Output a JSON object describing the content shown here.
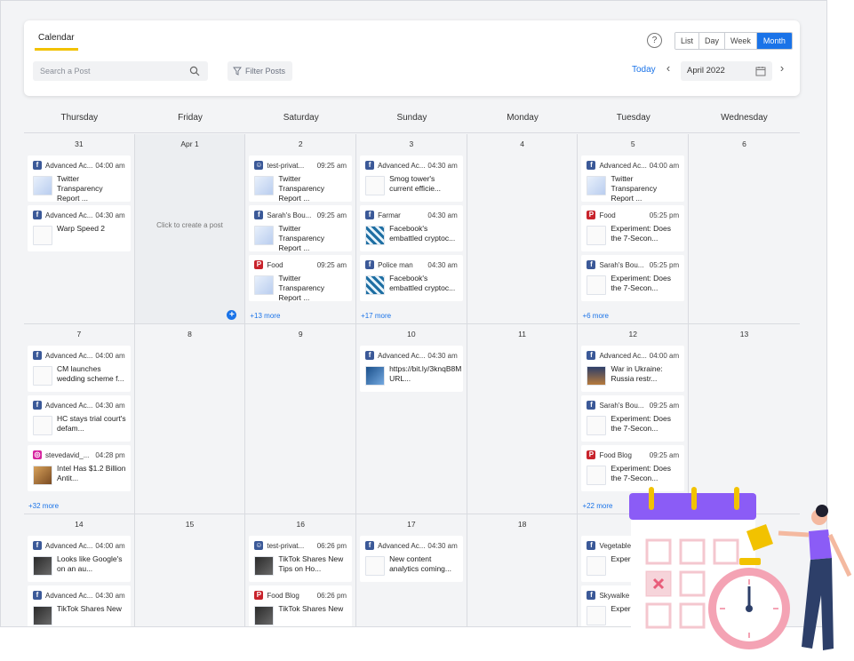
{
  "header": {
    "tab_label": "Calendar",
    "search_placeholder": "Search a Post",
    "filter_label": "Filter Posts",
    "help": "?",
    "views": [
      "List",
      "Day",
      "Week",
      "Month"
    ],
    "active_view": "Month",
    "today_label": "Today",
    "month_value": "April 2022"
  },
  "day_names": [
    "Thursday",
    "Friday",
    "Saturday",
    "Sunday",
    "Monday",
    "Tuesday",
    "Wednesday"
  ],
  "weeks": [
    {
      "days": [
        {
          "num": "31",
          "more": "",
          "posts": [
            {
              "icon": "fb",
              "account": "Advanced Ac...",
              "time": "04:00 am",
              "thumb": "",
              "text": "Twitter Transparency Report ..."
            },
            {
              "icon": "fb",
              "account": "Advanced Ac...",
              "time": "04:30 am",
              "thumb": "plain",
              "text": "Warp Speed 2"
            }
          ]
        },
        {
          "num": "Apr 1",
          "gray": true,
          "hint": "Click to create a post",
          "more": "",
          "posts": []
        },
        {
          "num": "2",
          "more": "+13 more",
          "posts": [
            {
              "icon": "grp",
              "account": "test-privat...",
              "time": "09:25 am",
              "thumb": "",
              "text": "Twitter Transparency Report ..."
            },
            {
              "icon": "fb",
              "account": "Sarah's Bou...",
              "time": "09:25 am",
              "thumb": "",
              "text": "Twitter Transparency Report ..."
            },
            {
              "icon": "pin",
              "account": "Food",
              "time": "09:25 am",
              "thumb": "",
              "text": "Twitter Transparency Report ..."
            }
          ]
        },
        {
          "num": "3",
          "more": "+17 more",
          "posts": [
            {
              "icon": "fb",
              "account": "Advanced Ac...",
              "time": "04:30 am",
              "thumb": "plain",
              "text": "Smog tower's current efficie..."
            },
            {
              "icon": "fb",
              "account": "Farmar",
              "time": "04:30 am",
              "thumb": "wave",
              "text": "Facebook's embattled cryptoc..."
            },
            {
              "icon": "fb",
              "account": "Police man",
              "time": "04:30 am",
              "thumb": "wave",
              "text": "Facebook's embattled cryptoc..."
            }
          ]
        },
        {
          "num": "4",
          "more": "",
          "posts": []
        },
        {
          "num": "5",
          "more": "+6 more",
          "posts": [
            {
              "icon": "fb",
              "account": "Advanced Ac...",
              "time": "04:00 am",
              "thumb": "",
              "text": "Twitter Transparency Report ..."
            },
            {
              "icon": "pin",
              "account": "Food",
              "time": "05:25 pm",
              "thumb": "plain",
              "text": "Experiment: Does the 7-Secon..."
            },
            {
              "icon": "fb",
              "account": "Sarah's Bou...",
              "time": "05:25 pm",
              "thumb": "plain",
              "text": "Experiment: Does the 7-Secon..."
            }
          ]
        },
        {
          "num": "6",
          "more": "",
          "posts": []
        }
      ]
    },
    {
      "days": [
        {
          "num": "7",
          "more": "+32 more",
          "posts": [
            {
              "icon": "fb",
              "account": "Advanced Ac...",
              "time": "04:00 am",
              "thumb": "plain",
              "text": "CM launches wedding scheme f..."
            },
            {
              "icon": "fb",
              "account": "Advanced Ac...",
              "time": "04:30 am",
              "thumb": "plain",
              "text": "HC stays trial court's defam..."
            },
            {
              "icon": "ig",
              "account": "stevedavid_...",
              "time": "04:28 pm",
              "thumb": "food",
              "text": "Intel Has $1.2 Billion Antit..."
            }
          ]
        },
        {
          "num": "8",
          "more": "",
          "posts": []
        },
        {
          "num": "9",
          "more": "",
          "posts": []
        },
        {
          "num": "10",
          "more": "",
          "posts": [
            {
              "icon": "fb",
              "account": "Advanced Ac...",
              "time": "04:30 am",
              "thumb": "blue",
              "text": "https://bit.ly/3knqB8M URL..."
            }
          ]
        },
        {
          "num": "11",
          "more": "",
          "posts": []
        },
        {
          "num": "12",
          "more": "+22 more",
          "posts": [
            {
              "icon": "fb",
              "account": "Advanced Ac...",
              "time": "04:00 am",
              "thumb": "war",
              "text": "War in Ukraine: Russia restr..."
            },
            {
              "icon": "fb",
              "account": "Sarah's Bou...",
              "time": "09:25 am",
              "thumb": "plain",
              "text": "Experiment: Does the 7-Secon..."
            },
            {
              "icon": "pin",
              "account": "Food Blog",
              "time": "09:25 am",
              "thumb": "plain",
              "text": "Experiment: Does the 7-Secon..."
            }
          ]
        },
        {
          "num": "13",
          "more": "",
          "posts": []
        }
      ]
    },
    {
      "days": [
        {
          "num": "14",
          "more": "",
          "posts": [
            {
              "icon": "fb",
              "account": "Advanced Ac...",
              "time": "04:00 am",
              "thumb": "dark",
              "text": "Looks like Google's on an au..."
            },
            {
              "icon": "fb",
              "account": "Advanced Ac...",
              "time": "04:30 am",
              "thumb": "dark",
              "text": "TikTok Shares New"
            }
          ]
        },
        {
          "num": "15",
          "more": "",
          "posts": []
        },
        {
          "num": "16",
          "more": "",
          "posts": [
            {
              "icon": "grp",
              "account": "test-privat...",
              "time": "06:26 pm",
              "thumb": "dark",
              "text": "TikTok Shares New Tips on Ho..."
            },
            {
              "icon": "pin",
              "account": "Food Blog",
              "time": "06:26 pm",
              "thumb": "dark",
              "text": "TikTok Shares New"
            }
          ]
        },
        {
          "num": "17",
          "more": "",
          "posts": [
            {
              "icon": "fb",
              "account": "Advanced Ac...",
              "time": "04:30 am",
              "thumb": "plain",
              "text": "New content analytics coming..."
            }
          ]
        },
        {
          "num": "18",
          "more": "",
          "posts": []
        },
        {
          "num": "",
          "more": "",
          "posts": [
            {
              "icon": "fb",
              "account": "Vegetable",
              "time": "",
              "thumb": "plain",
              "text": "Experim 7-Secon"
            },
            {
              "icon": "fb",
              "account": "Skywalke",
              "time": "",
              "thumb": "plain",
              "text": "Experim"
            }
          ]
        },
        {
          "num": "",
          "more": "",
          "posts": []
        }
      ]
    }
  ],
  "colors": {
    "accent": "#1a73e8",
    "tab_underline": "#f2c200",
    "illustration_purple": "#8b5cf6",
    "illustration_pink": "#f4a3b4"
  }
}
